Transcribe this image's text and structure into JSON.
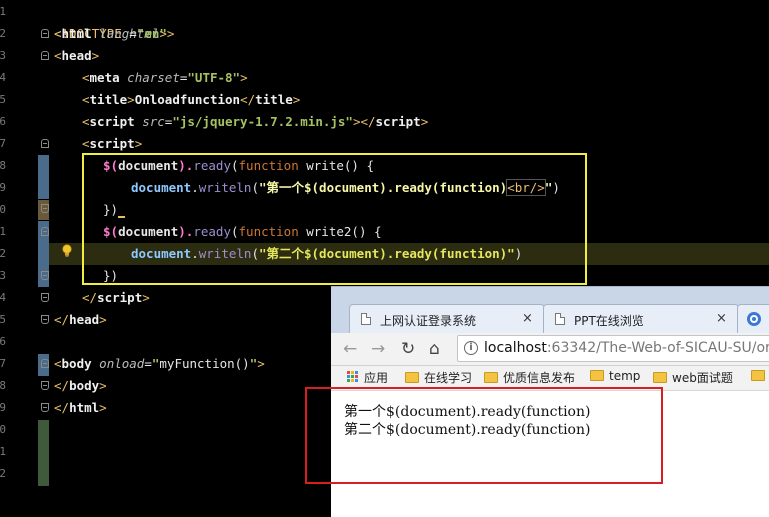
{
  "editor": {
    "line_numbers": [
      "1",
      "2",
      "3",
      "4",
      "5",
      "6",
      "7",
      "8",
      "9",
      "0",
      "1",
      "2",
      "3",
      "4",
      "5",
      "6",
      "7",
      "8",
      "9",
      "0",
      "1",
      "2"
    ],
    "lines": {
      "l1": [
        "<!DOCTYPE ",
        "html",
        ">"
      ],
      "l2": [
        "<",
        "html",
        " ",
        "lang",
        "=",
        "\"en\"",
        ">"
      ],
      "l3": [
        "<",
        "head",
        ">"
      ],
      "l4": [
        "<",
        "meta",
        " ",
        "charset",
        "=",
        "\"UTF-8\"",
        ">"
      ],
      "l5": [
        "<",
        "title",
        ">",
        "Onloadfunction",
        "</",
        "title",
        ">"
      ],
      "l6": [
        "<",
        "script",
        " ",
        "src",
        "=",
        "\"js/jquery-1.7.2.min.js\"",
        "></",
        "script",
        ">"
      ],
      "l7": [
        "<",
        "script",
        ">"
      ],
      "l8": [
        "$(",
        "document",
        ").",
        "ready",
        "(",
        "function",
        " write",
        "() {"
      ],
      "l9": [
        "document",
        ".",
        "writeln",
        "(",
        "\"第一个$(document).ready(function)",
        "<br/>",
        "\"",
        ")"
      ],
      "l10": [
        "})"
      ],
      "l11": [
        "$(",
        "document",
        ").",
        "ready",
        "(",
        "function",
        " write2",
        "() {"
      ],
      "l12": [
        "document",
        ".",
        "writeln",
        "(",
        "\"第二个$(document).ready(function)\"",
        ")"
      ],
      "l13": [
        "})"
      ],
      "l14": [
        "</",
        "script",
        ">"
      ],
      "l15": [
        "</",
        "head",
        ">"
      ],
      "l17": [
        "<",
        "body",
        " ",
        "onload",
        "=",
        "\"",
        "myFunction()",
        "\"",
        ">"
      ],
      "l18": [
        "</",
        "body",
        ">"
      ],
      "l19": [
        "</",
        "html",
        ">"
      ]
    }
  },
  "browser": {
    "tabs": [
      {
        "label": "上网认证登录系统",
        "close": "×"
      },
      {
        "label": "PPT在线浏览",
        "close": "×"
      }
    ],
    "nav": {
      "back": "←",
      "forward": "→",
      "reload": "↻",
      "home": "⌂"
    },
    "url": {
      "host": "localhost",
      "rest": ":63342/The-Web-of-SICAU-SU/or"
    },
    "bookmarks": [
      "应用",
      "在线学习",
      "优质信息发布",
      "temp",
      "web面试题"
    ],
    "output": [
      "第一个$(document).ready(function)",
      "第二个$(document).ready(function)"
    ]
  },
  "colors": {
    "yellow_annotation": "#f2ef3c",
    "red_annotation": "#d81e1e",
    "tag": "#e8bf6a",
    "string": "#a5c261"
  }
}
